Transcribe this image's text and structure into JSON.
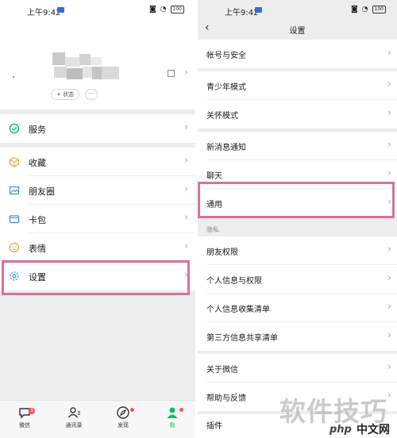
{
  "status_bar": {
    "time": "上午9:42",
    "battery": "100"
  },
  "profile": {
    "status_button": "+ 状态",
    "more_button": "···"
  },
  "left_menu": [
    {
      "label": "服务",
      "icon": "service-icon"
    },
    {
      "label": "收藏",
      "icon": "favorites-icon"
    },
    {
      "label": "朋友圈",
      "icon": "moments-icon"
    },
    {
      "label": "卡包",
      "icon": "card-wallet-icon"
    },
    {
      "label": "表情",
      "icon": "sticker-icon"
    },
    {
      "label": "设置",
      "icon": "settings-gear-icon"
    }
  ],
  "tabbar": [
    {
      "label": "微信",
      "badge": "3"
    },
    {
      "label": "通讯录"
    },
    {
      "label": "发现"
    },
    {
      "label": "我"
    }
  ],
  "settings": {
    "title": "设置",
    "items": [
      {
        "label": "帐号与安全"
      },
      {
        "label": "青少年模式"
      },
      {
        "label": "关怀模式"
      },
      {
        "label": "新消息通知"
      },
      {
        "label": "聊天"
      },
      {
        "label": "通用"
      }
    ],
    "privacy_label": "隐私",
    "privacy_items": [
      {
        "label": "朋友权限"
      },
      {
        "label": "个人信息与权限"
      },
      {
        "label": "个人信息收集清单"
      },
      {
        "label": "第三方信息共享清单"
      }
    ],
    "more_items": [
      {
        "label": "关于微信"
      },
      {
        "label": "帮助与反馈"
      },
      {
        "label": "插件"
      }
    ]
  },
  "watermark": {
    "text": "软件技巧",
    "logo": "php",
    "logo_cn": "中文网"
  },
  "colors": {
    "highlight": "#d9709c",
    "accent": "#07c160",
    "badge": "#fa5151",
    "background": "#ededed"
  }
}
